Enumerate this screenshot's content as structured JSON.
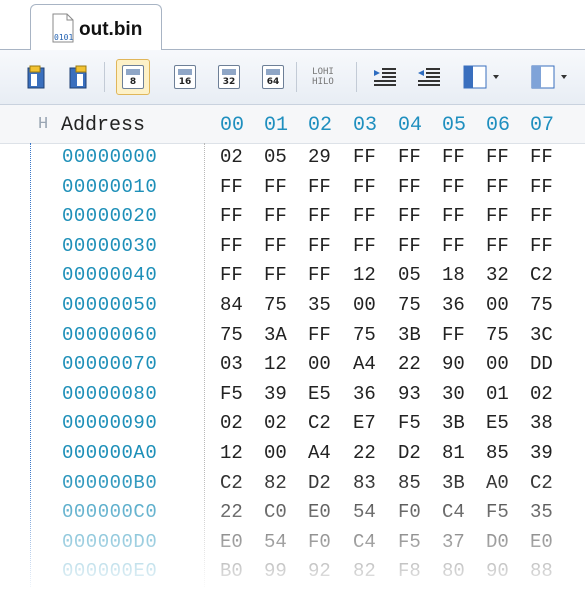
{
  "tab": {
    "label": "out.bin",
    "icon": "binary-file-icon",
    "icon_text": "0101"
  },
  "toolbar": {
    "buttons": [
      {
        "name": "copy-left-icon"
      },
      {
        "name": "copy-right-icon"
      },
      {
        "name": "bytes-8-icon",
        "label": "8",
        "active": true
      },
      {
        "name": "bytes-16-icon",
        "label": "16"
      },
      {
        "name": "bytes-32-icon",
        "label": "32"
      },
      {
        "name": "bytes-64-icon",
        "label": "64"
      },
      {
        "name": "lohi-swap-icon",
        "label_top": "LOHI",
        "label_bottom": "HILO"
      },
      {
        "name": "indent-left-icon"
      },
      {
        "name": "indent-right-icon"
      },
      {
        "name": "panel-left-icon"
      },
      {
        "name": "panel-right-icon"
      }
    ]
  },
  "columns": {
    "marker": "H",
    "address_label": "Address",
    "hex": [
      "00",
      "01",
      "02",
      "03",
      "04",
      "05",
      "06",
      "07"
    ]
  },
  "rows": [
    {
      "address": "00000000",
      "bytes": [
        "02",
        "05",
        "29",
        "FF",
        "FF",
        "FF",
        "FF",
        "FF"
      ]
    },
    {
      "address": "00000010",
      "bytes": [
        "FF",
        "FF",
        "FF",
        "FF",
        "FF",
        "FF",
        "FF",
        "FF"
      ]
    },
    {
      "address": "00000020",
      "bytes": [
        "FF",
        "FF",
        "FF",
        "FF",
        "FF",
        "FF",
        "FF",
        "FF"
      ]
    },
    {
      "address": "00000030",
      "bytes": [
        "FF",
        "FF",
        "FF",
        "FF",
        "FF",
        "FF",
        "FF",
        "FF"
      ]
    },
    {
      "address": "00000040",
      "bytes": [
        "FF",
        "FF",
        "FF",
        "12",
        "05",
        "18",
        "32",
        "C2"
      ]
    },
    {
      "address": "00000050",
      "bytes": [
        "84",
        "75",
        "35",
        "00",
        "75",
        "36",
        "00",
        "75"
      ]
    },
    {
      "address": "00000060",
      "bytes": [
        "75",
        "3A",
        "FF",
        "75",
        "3B",
        "FF",
        "75",
        "3C"
      ]
    },
    {
      "address": "00000070",
      "bytes": [
        "03",
        "12",
        "00",
        "A4",
        "22",
        "90",
        "00",
        "DD"
      ]
    },
    {
      "address": "00000080",
      "bytes": [
        "F5",
        "39",
        "E5",
        "36",
        "93",
        "30",
        "01",
        "02"
      ]
    },
    {
      "address": "00000090",
      "bytes": [
        "02",
        "02",
        "C2",
        "E7",
        "F5",
        "3B",
        "E5",
        "38"
      ]
    },
    {
      "address": "000000A0",
      "bytes": [
        "12",
        "00",
        "A4",
        "22",
        "D2",
        "81",
        "85",
        "39"
      ]
    },
    {
      "address": "000000B0",
      "bytes": [
        "C2",
        "82",
        "D2",
        "83",
        "85",
        "3B",
        "A0",
        "C2"
      ]
    },
    {
      "address": "000000C0",
      "bytes": [
        "22",
        "C0",
        "E0",
        "54",
        "F0",
        "C4",
        "F5",
        "35"
      ]
    },
    {
      "address": "000000D0",
      "bytes": [
        "E0",
        "54",
        "F0",
        "C4",
        "F5",
        "37",
        "D0",
        "E0"
      ]
    },
    {
      "address": "000000E0",
      "bytes": [
        "B0",
        "99",
        "92",
        "82",
        "F8",
        "80",
        "90",
        "88"
      ]
    }
  ],
  "colors": {
    "address": "#1d8fb8",
    "hex_header": "#1f8fbf",
    "active_button": "#fdf1c8"
  }
}
